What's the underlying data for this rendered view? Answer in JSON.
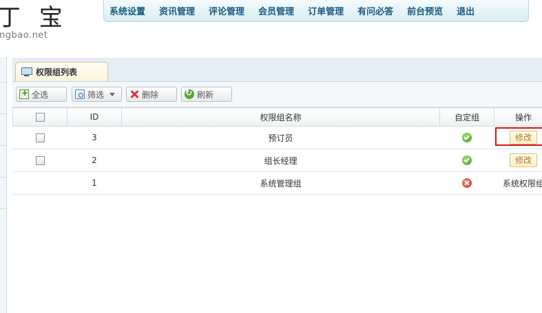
{
  "logo": {
    "main": "丁 宝",
    "sub": "ngbao.net"
  },
  "nav": {
    "items": [
      "系统设置",
      "资讯管理",
      "评论管理",
      "会员管理",
      "订单管理",
      "有问必答",
      "前台预览",
      "退出"
    ]
  },
  "tab": {
    "label": "权限组列表",
    "icon": "monitor-icon"
  },
  "toolbar": {
    "select_all": "全选",
    "filter": "筛选",
    "delete": "删除",
    "refresh": "刷新"
  },
  "table": {
    "headers": {
      "id": "ID",
      "name": "权限组名称",
      "custom": "自定组",
      "action": "操作"
    },
    "rows": [
      {
        "id": "3",
        "name": "预订员",
        "custom": "yes",
        "action": "修改"
      },
      {
        "id": "2",
        "name": "组长经理",
        "custom": "yes",
        "action": "修改"
      },
      {
        "id": "1",
        "name": "系统管理组",
        "custom": "no",
        "action": "系统权限组"
      }
    ]
  },
  "colors": {
    "nav_text": "#1b5a82",
    "highlight": "#d21414",
    "edit_text": "#b5761a"
  }
}
